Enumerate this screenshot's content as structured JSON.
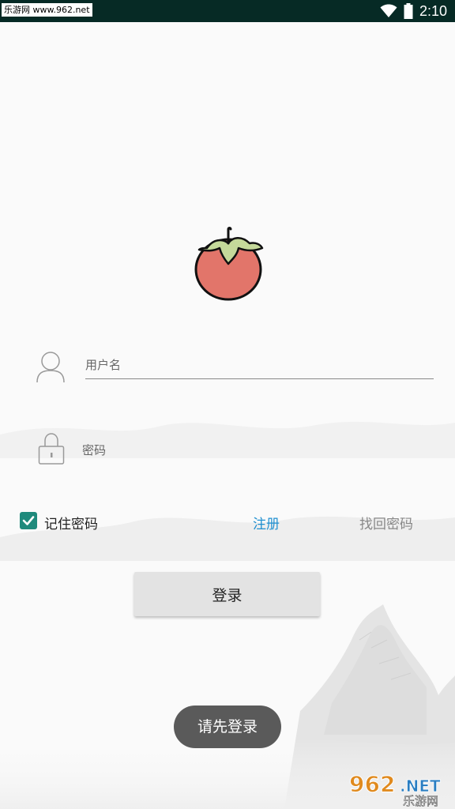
{
  "status_bar": {
    "watermark": "乐游网 www.962.net",
    "time": "2:10"
  },
  "login": {
    "username_placeholder": "用户名",
    "password_placeholder": "密码",
    "remember_label": "记住密码",
    "remember_checked": true,
    "register_label": "注册",
    "forgot_label": "找回密码",
    "login_button": "登录"
  },
  "toast": {
    "message": "请先登录"
  },
  "corner_watermark": {
    "number": "962",
    "suffix": ".NET",
    "brand": "乐游网"
  },
  "colors": {
    "status_bar": "#062a25",
    "accent": "#1f8a7c",
    "link": "#1f8fd0",
    "tomato": "#e2756a"
  },
  "icons": [
    "wifi-icon",
    "battery-icon",
    "user-icon",
    "lock-icon",
    "check-icon",
    "tomato-logo"
  ]
}
